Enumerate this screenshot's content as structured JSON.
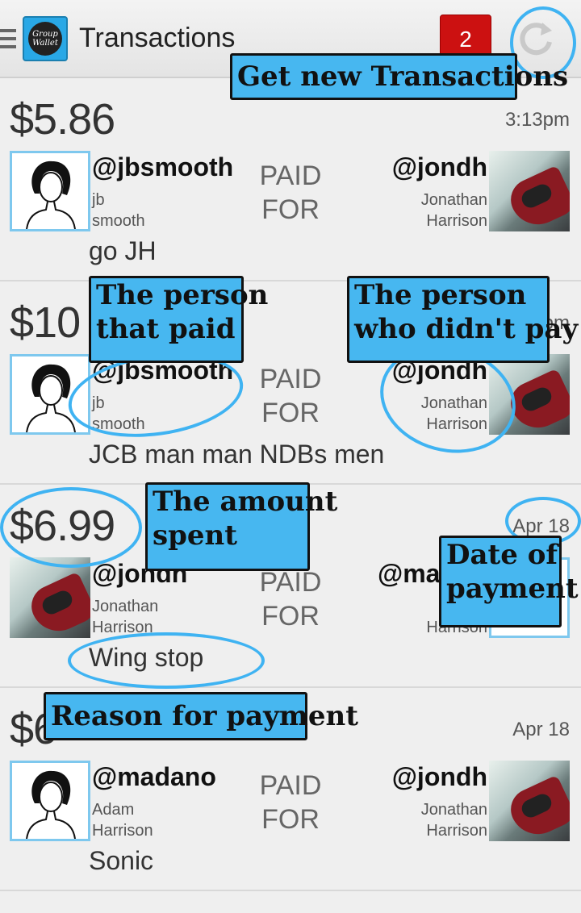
{
  "actionbar": {
    "title": "Transactions",
    "notification_count": "2"
  },
  "logo_text": "Group Wallet",
  "paid_label_1": "PAID",
  "paid_label_2": "FOR",
  "transactions": [
    {
      "amount": "$5.86",
      "date": "3:13pm",
      "payer_handle": "@jbsmooth",
      "payer_first": "jb",
      "payer_last": "smooth",
      "payee_handle": "@jondh",
      "payee_first": "Jonathan",
      "payee_last": "Harrison",
      "memo": "go JH"
    },
    {
      "amount": "$10",
      "date": "pm",
      "payer_handle": "@jbsmooth",
      "payer_first": "jb",
      "payer_last": "smooth",
      "payee_handle": "@jondh",
      "payee_first": "Jonathan",
      "payee_last": "Harrison",
      "memo": "JCB man man NDBs men"
    },
    {
      "amount": "$6.99",
      "date": "Apr 18",
      "payer_handle": "@jondh",
      "payer_first": "Jonathan",
      "payer_last": "Harrison",
      "payee_handle": "@ma",
      "payee_first": "",
      "payee_last": "Harrison",
      "memo": "Wing stop"
    },
    {
      "amount": "$6",
      "date": "Apr 18",
      "payer_handle": "@madano",
      "payer_first": "Adam",
      "payer_last": "Harrison",
      "payee_handle": "@jondh",
      "payee_first": "Jonathan",
      "payee_last": "Harrison",
      "memo": "Sonic"
    }
  ],
  "annotations": {
    "get_new": "Get new Transactions",
    "person_paid_1": "The person",
    "person_paid_2": "that paid",
    "person_not_paid_1": "The person",
    "person_not_paid_2": "who didn't pay",
    "amount_spent_1": "The amount",
    "amount_spent_2": "spent",
    "date_payment_1": "Date of",
    "date_payment_2": "payment",
    "reason": "Reason for payment"
  },
  "colors": {
    "annotation_fill": "#47b7f0",
    "badge": "#cc1111"
  }
}
